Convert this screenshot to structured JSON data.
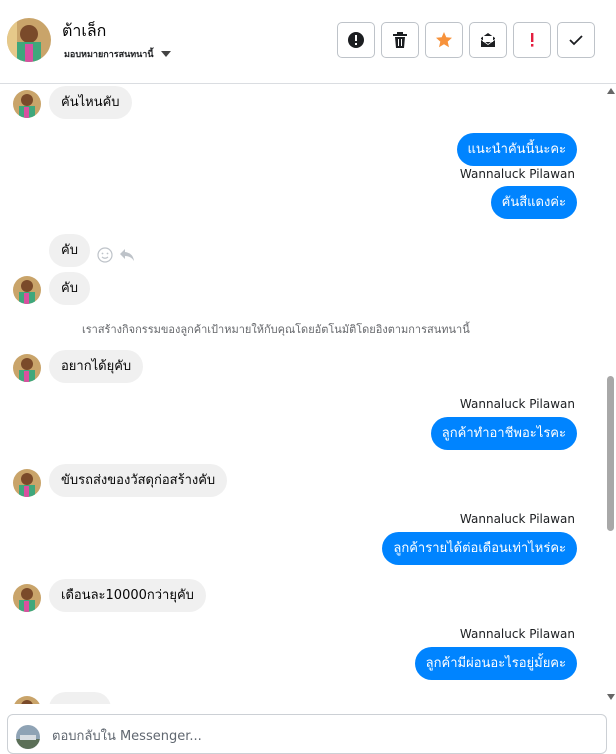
{
  "header": {
    "contact_name": "ต้าเล็ก",
    "assign_label": "มอบหมายการสนทนานี้",
    "toolbar": [
      {
        "icon": "alert-icon",
        "name": "mark-spam-button"
      },
      {
        "icon": "trash-icon",
        "name": "delete-button"
      },
      {
        "icon": "star-icon",
        "name": "star-button"
      },
      {
        "icon": "mark-unread-icon",
        "name": "mark-unread-button"
      },
      {
        "icon": "exclamation-icon",
        "name": "follow-up-button"
      },
      {
        "icon": "check-icon",
        "name": "mark-done-button"
      }
    ]
  },
  "messages": {
    "m1": "คันไหนคับ",
    "m2": "แนะนำคันนี้นะคะ",
    "m3_sender": "Wannaluck Pilawan",
    "m3": "คันสีแดงค่ะ",
    "m4": "คับ",
    "m5": "คับ",
    "system_note": "เราสร้างกิจกรรมของลูกค้าเป้าหมายให้กับคุณโดยอัตโนมัติโดยอิงตามการสนทนานี้",
    "m6": "อยากได้ยุคับ",
    "m7_sender": "Wannaluck Pilawan",
    "m7": "ลูกค้าทำอาชีพอะไรคะ",
    "m8": "ขับรถส่งของวัสดุก่อสร้างคับ",
    "m9_sender": "Wannaluck Pilawan",
    "m9": "ลูกค้ารายได้ต่อเดือนเท่าไหร่คะ",
    "m10": "เดือนละ10000กว่ายุคับ",
    "m11_sender": "Wannaluck Pilawan",
    "m11": "ลูกค้ามีผ่อนอะไรอยู่มั้ยคะ"
  },
  "composer": {
    "placeholder": "ตอบกลับใน Messenger..."
  },
  "colors": {
    "outgoing_bubble": "#0084ff",
    "incoming_bubble": "#f0f0f0",
    "star": "#f7923b",
    "alert_red": "#e41e3f"
  }
}
